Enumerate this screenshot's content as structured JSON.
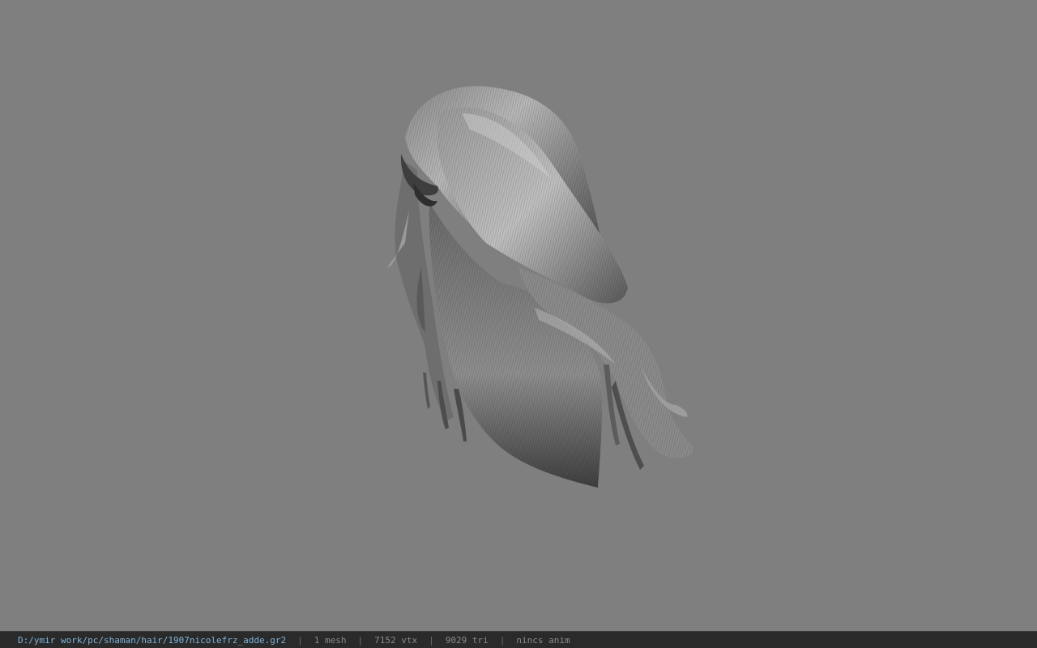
{
  "viewport": {
    "background": "#7f7f7f",
    "model_kind": "hair-mesh"
  },
  "status": {
    "file_path": "D:/ymir work/pc/shaman/hair/1907nicolefrz_adde.gr2",
    "separator": "|",
    "mesh_count": "1 mesh",
    "vertex_count": "7152 vtx",
    "triangle_count": "9029 tri",
    "anim_info": "nincs anim",
    "path_color": "#7fb3d9",
    "text_color": "#8a8a8a"
  }
}
